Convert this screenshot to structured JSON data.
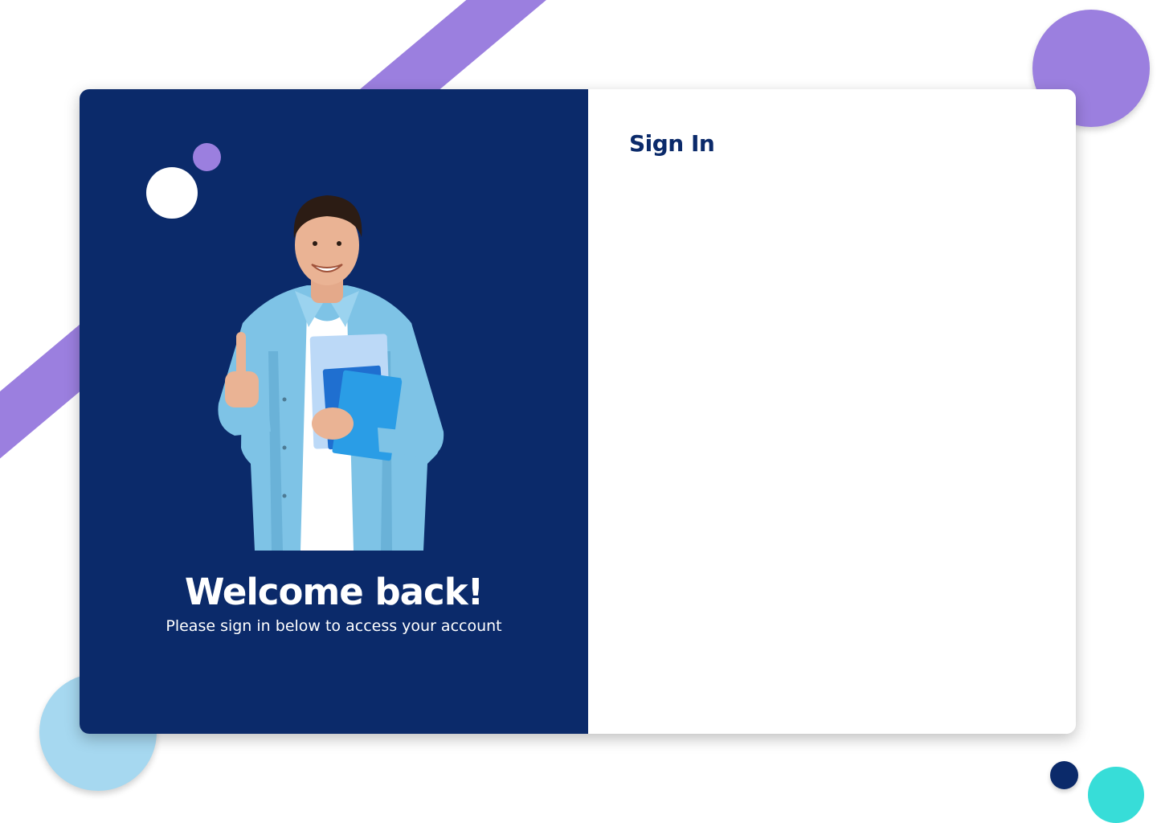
{
  "colors": {
    "navy": "#0b2a6a",
    "purple": "#9b7fdf",
    "light_blue": "#a6d8f0",
    "teal": "#37ddd8",
    "white": "#ffffff"
  },
  "left_panel": {
    "hero_image": "student-thumbs-up-with-notebooks",
    "welcome_title": "Welcome back!",
    "welcome_subtitle": "Please sign in below to access your account"
  },
  "right_panel": {
    "title": "Sign In"
  }
}
